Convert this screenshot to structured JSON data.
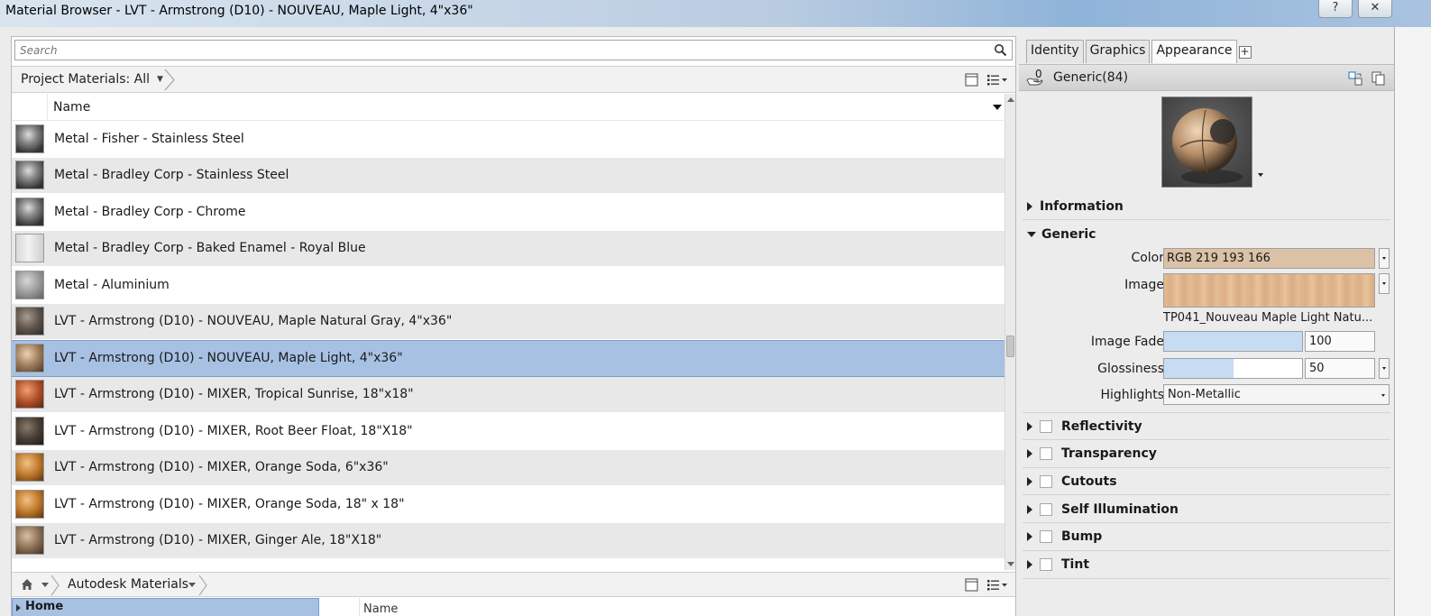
{
  "window": {
    "title": "Material Browser - LVT - Armstrong (D10) - NOUVEAU, Maple Light, 4\"x36\"",
    "help_label": "?",
    "close_label": "✕"
  },
  "left": {
    "search_placeholder": "Search",
    "breadcrumb": "Project Materials: All",
    "column_name": "Name",
    "materials": [
      {
        "label": "Metal - Fisher - Stainless Steel",
        "swatch": "metal-dark"
      },
      {
        "label": "Metal - Bradley Corp - Stainless Steel",
        "swatch": "metal-dark"
      },
      {
        "label": "Metal - Bradley Corp - Chrome",
        "swatch": "metal-dark"
      },
      {
        "label": "Metal - Bradley Corp - Baked Enamel - Royal Blue",
        "swatch": "enamel-light"
      },
      {
        "label": "Metal - Aluminium",
        "swatch": "aluminium"
      },
      {
        "label": "LVT - Armstrong (D10) - NOUVEAU, Maple Natural Gray, 4\"x36\"",
        "swatch": "wood-gray"
      },
      {
        "label": "LVT - Armstrong (D10) - NOUVEAU, Maple Light, 4\"x36\"",
        "swatch": "wood-light",
        "selected": true
      },
      {
        "label": "LVT - Armstrong (D10) - MIXER, Tropical Sunrise, 18\"x18\"",
        "swatch": "wood-orange-red"
      },
      {
        "label": "LVT - Armstrong (D10) - MIXER, Root Beer Float, 18\"X18\"",
        "swatch": "wood-dark"
      },
      {
        "label": "LVT - Armstrong (D10) - MIXER, Orange Soda, 6\"x36\"",
        "swatch": "wood-orange"
      },
      {
        "label": "LVT - Armstrong (D10) - MIXER, Orange Soda, 18\" x 18\"",
        "swatch": "wood-orange"
      },
      {
        "label": "LVT - Armstrong (D10) - MIXER, Ginger Ale, 18\"X18\"",
        "swatch": "wood-tan"
      }
    ],
    "library_name": "Autodesk Materials",
    "tree_item": "Home",
    "library_column": "Name"
  },
  "right": {
    "tabs": [
      "Identity",
      "Graphics",
      "Appearance"
    ],
    "active_tab": "Appearance",
    "add_tab": "+",
    "asset_users": "0",
    "asset_name": "Generic(84)",
    "sections_top": [
      "Information",
      "Generic"
    ],
    "properties": {
      "color_label": "Color",
      "color_value": "RGB 219 193 166",
      "image_label": "Image",
      "image_name": "TP041_Nouveau Maple Light Natu...",
      "image_fade_label": "Image Fade",
      "image_fade_value": "100",
      "glossiness_label": "Glossiness",
      "glossiness_value": "50",
      "highlights_label": "Highlights",
      "highlights_value": "Non-Metallic"
    },
    "sections_bottom": [
      "Reflectivity",
      "Transparency",
      "Cutouts",
      "Self Illumination",
      "Bump",
      "Tint"
    ]
  },
  "colors": {
    "selection": "#a7c1e3",
    "color_swatch": "#dbc1a6",
    "slider_fill": "#c6dcf3"
  },
  "levels": {
    "image_fade_fraction": 1.0,
    "glossiness_fraction": 0.5
  }
}
